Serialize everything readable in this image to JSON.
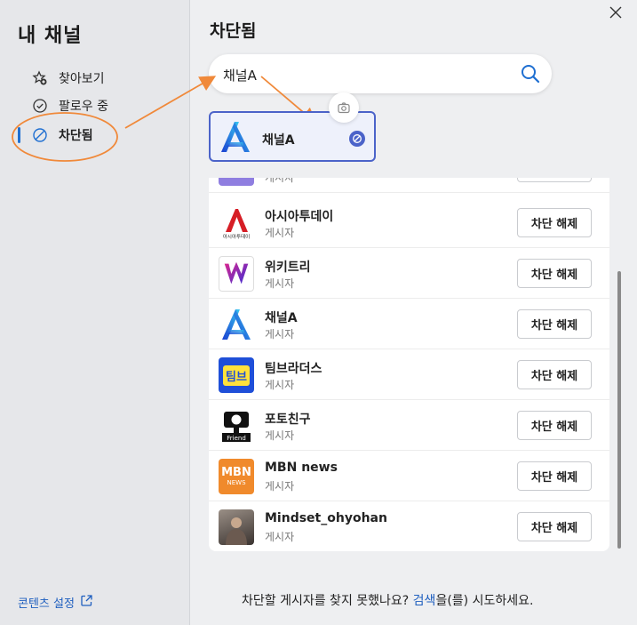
{
  "sidebar": {
    "title": "내 채널",
    "items": [
      {
        "label": "찾아보기",
        "icon": "star-add-icon"
      },
      {
        "label": "팔로우 중",
        "icon": "check-circle-icon"
      },
      {
        "label": "차단됨",
        "icon": "block-icon",
        "active": true
      }
    ],
    "content_settings": "콘텐츠 설정"
  },
  "main": {
    "title": "차단됨",
    "search": {
      "value": "채널A",
      "placeholder": ""
    },
    "search_result": {
      "name": "채널A"
    },
    "list": [
      {
        "name": "",
        "role": "게시자",
        "button": ""
      },
      {
        "name": "아시아투데이",
        "role": "게시자",
        "button": "차단 해제"
      },
      {
        "name": "위키트리",
        "role": "게시자",
        "button": "차단 해제"
      },
      {
        "name": "채널A",
        "role": "게시자",
        "button": "차단 해제"
      },
      {
        "name": "팀브라더스",
        "role": "게시자",
        "button": "차단 해제"
      },
      {
        "name": "포토친구",
        "role": "게시자",
        "button": "차단 해제"
      },
      {
        "name": "MBN news",
        "role": "게시자",
        "button": "차단 해제"
      },
      {
        "name": "Mindset_ohyohan",
        "role": "게시자",
        "button": "차단 해제"
      }
    ],
    "logo_texts": {
      "teambro": "팀브",
      "photo": "Friend",
      "mbn_top": "MBN",
      "mbn_bottom": "NEWS",
      "asiatoday": "아시아투데이"
    },
    "bottom_note": {
      "prefix": "차단할 게시자를 찾지 못했나요? ",
      "link": "검색",
      "suffix": "을(를) 시도하세요."
    }
  },
  "colors": {
    "accent": "#1f6fd1",
    "highlight_border": "#4b63c9",
    "annotation": "#f0893a"
  }
}
